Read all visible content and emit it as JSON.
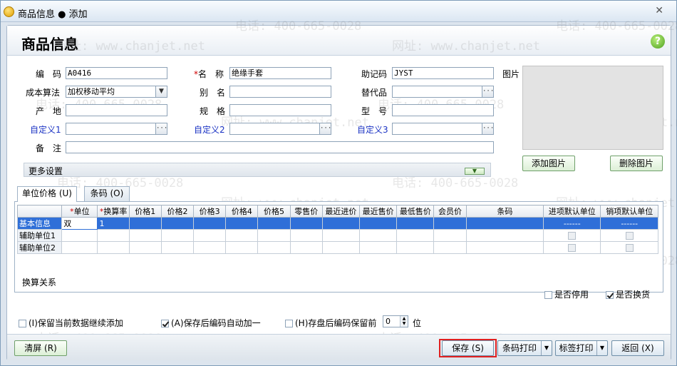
{
  "window": {
    "title": "商品信息 ● 添加"
  },
  "header": {
    "title": "商品信息"
  },
  "watermarks": {
    "phone": "电话: 400-665-0028",
    "site": "网址: www.chanjet.net"
  },
  "form": {
    "code": {
      "label": "编　码",
      "value": "A0416"
    },
    "name": {
      "required_mark": "*",
      "label": "名　称",
      "value": "绝缘手套"
    },
    "mnemonic": {
      "label": "助记码",
      "value": "JYST"
    },
    "cost_method": {
      "label": "成本算法",
      "value": "加权移动平均"
    },
    "alias": {
      "label": "别　名",
      "value": ""
    },
    "substitute": {
      "label": "替代品",
      "value": ""
    },
    "origin": {
      "label": "产　地",
      "value": ""
    },
    "spec": {
      "label": "规　格",
      "value": ""
    },
    "model": {
      "label": "型　号",
      "value": ""
    },
    "custom1": {
      "label": "自定义1",
      "value": ""
    },
    "custom2": {
      "label": "自定义2",
      "value": ""
    },
    "custom3": {
      "label": "自定义3",
      "value": ""
    },
    "remark": {
      "label": "备　注",
      "value": ""
    }
  },
  "image": {
    "label": "图片",
    "add_button": "添加图片",
    "delete_button": "删除图片"
  },
  "more_settings": {
    "label": "更多设置",
    "chevron": "▼"
  },
  "tabs": [
    {
      "label": "单位价格 (U)",
      "active": true
    },
    {
      "label": "条码 (O)",
      "active": false
    }
  ],
  "unit_grid": {
    "columns": [
      "",
      "单位",
      "换算率",
      "价格1",
      "价格2",
      "价格3",
      "价格4",
      "价格5",
      "零售价",
      "最近进价",
      "最近售价",
      "最低售价",
      "会员价",
      "条码",
      "进项默认单位",
      "销项默认单位"
    ],
    "required_mark": "*",
    "rows": [
      {
        "head": "基本信息",
        "unit": "双",
        "rate": "1",
        "in_default": "------",
        "out_default": "------"
      },
      {
        "head": "辅助单位1",
        "unit": "",
        "rate": "",
        "in_default": "",
        "out_default": ""
      },
      {
        "head": "辅助单位2",
        "unit": "",
        "rate": "",
        "in_default": "",
        "out_default": ""
      }
    ]
  },
  "conversion": {
    "label": "换算关系"
  },
  "flags": {
    "disabled": {
      "label": "是否停用",
      "checked": false
    },
    "exchangeable": {
      "label": "是否换货",
      "checked": true
    }
  },
  "options": {
    "keep_data": {
      "label": "(I)保留当前数据继续添加",
      "checked": false
    },
    "auto_increment": {
      "label": "(A)保存后编码自动加一",
      "checked": true
    },
    "keep_prefix": {
      "label": "(H)存盘后编码保留前",
      "checked": false
    },
    "digits_value": "0",
    "digits_unit": "位"
  },
  "footer": {
    "clear_button": "清屏 (R)",
    "save_button": "保存 (S)",
    "barcode_print": "条码打印",
    "label_print": "标签打印",
    "return_button": "返回 (X)"
  }
}
